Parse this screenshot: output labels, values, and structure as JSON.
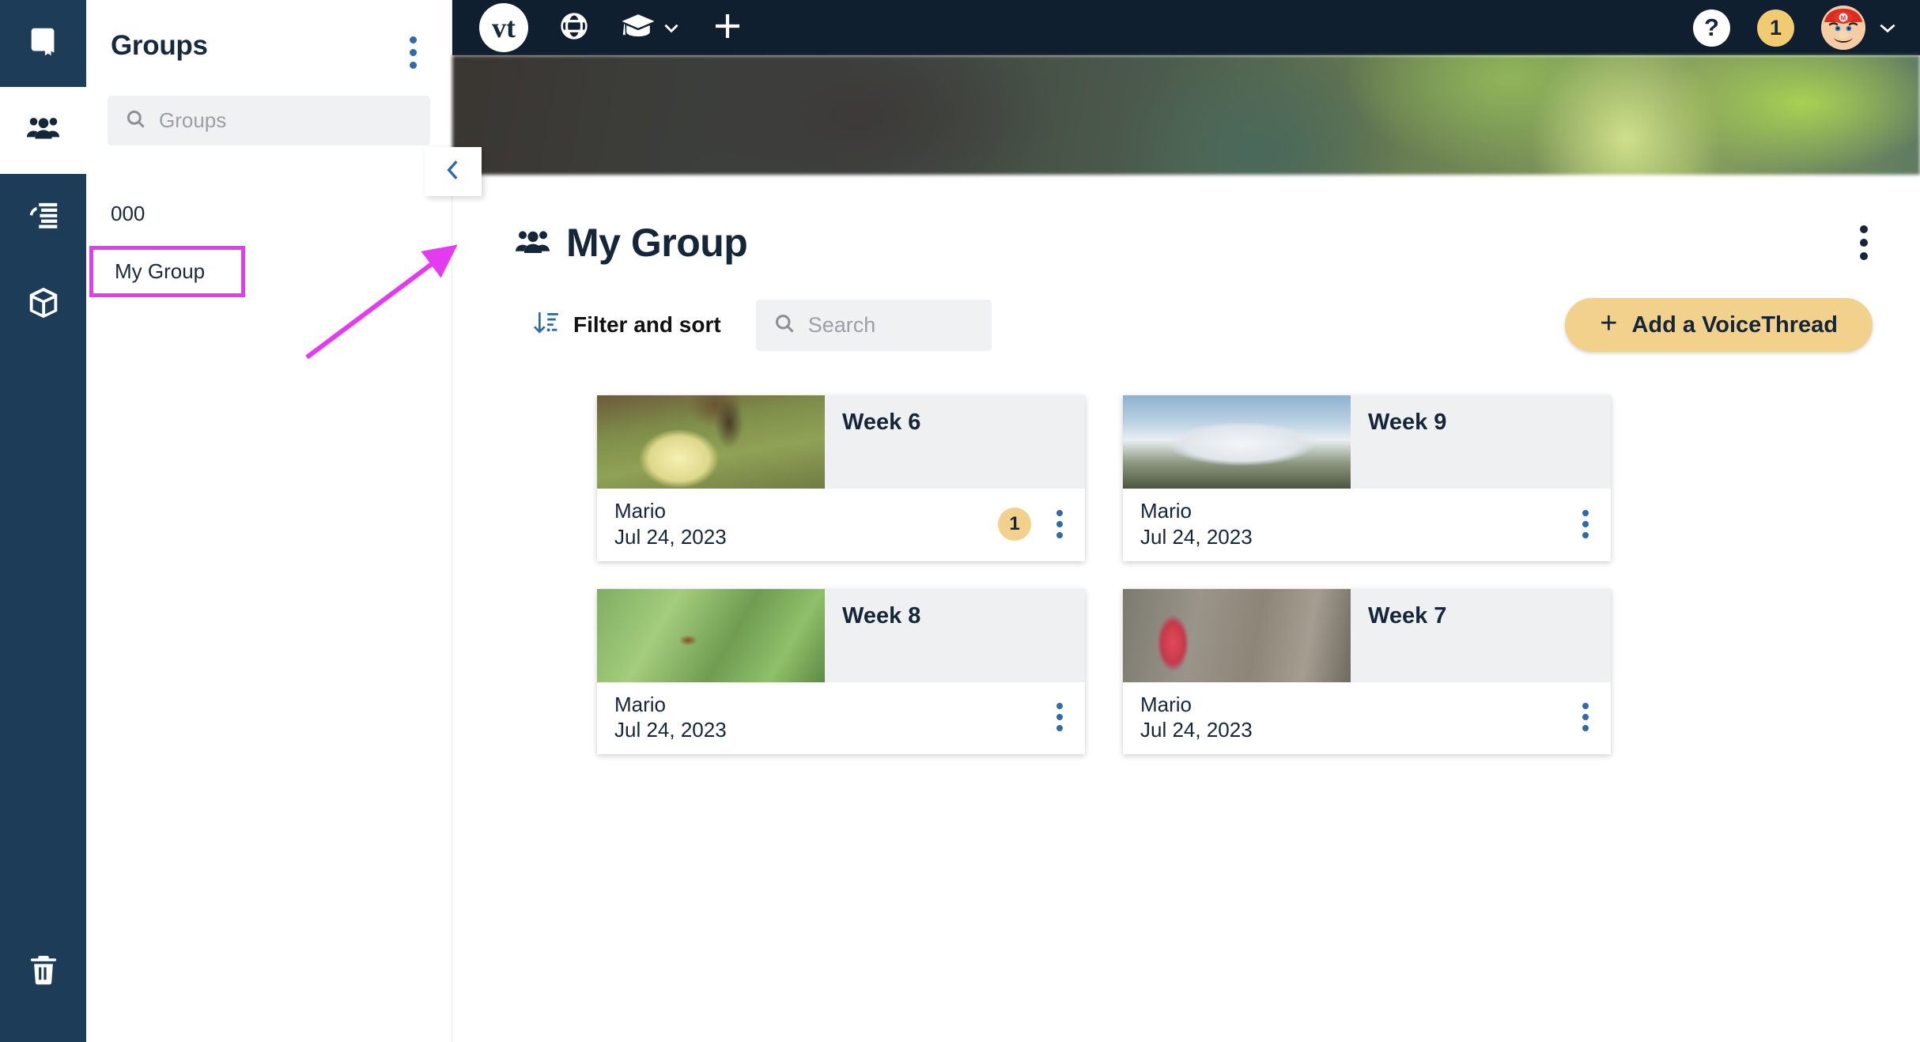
{
  "rail": {
    "items": [
      {
        "name": "courses",
        "icon": "book-icon",
        "active": false
      },
      {
        "name": "groups",
        "icon": "groups-icon",
        "active": true
      },
      {
        "name": "threads",
        "icon": "spool-icon",
        "active": false
      },
      {
        "name": "archive",
        "icon": "box-icon",
        "active": false
      }
    ],
    "trash": {
      "name": "trash",
      "icon": "trash-icon"
    }
  },
  "panel": {
    "title": "Groups",
    "menu_icon": "kebab-menu-icon",
    "search": {
      "placeholder": "Groups",
      "value": "",
      "icon": "search-icon"
    },
    "items": [
      {
        "label": "000",
        "highlighted": false
      },
      {
        "label": "My Group",
        "highlighted": true
      }
    ]
  },
  "collapse": {
    "icon": "chevron-left-icon",
    "label": ""
  },
  "annotation": {
    "highlight_color": "#e53bf0",
    "arrow_color": "#e53bf0",
    "target": "collapse-panel-tab"
  },
  "topnav": {
    "logo": "vt",
    "globe_icon": "globe-icon",
    "courses_icon": "graduation-cap-icon",
    "courses_chevron": "chevron-down-icon",
    "add_icon": "plus-icon",
    "help_label": "?",
    "notification_count": "1",
    "avatar": "mario-avatar",
    "account_chevron": "chevron-down-icon"
  },
  "page": {
    "icon": "groups-icon",
    "title": "My Group",
    "menu_icon": "kebab-menu-icon"
  },
  "toolbar": {
    "filter_sort_label": "Filter and sort",
    "filter_sort_icon": "sort-descending-icon",
    "search": {
      "placeholder": "Search",
      "value": "",
      "icon": "search-icon"
    },
    "add_button": {
      "label": "Add a VoiceThread",
      "plus": "+",
      "color": "#f2d18c"
    }
  },
  "cards": [
    {
      "title": "Week 6",
      "author": "Mario",
      "date": "Jul 24, 2023",
      "count": "1",
      "thumb_class": "thumb-gosling",
      "thumb_alt": "gosling-photo",
      "menu_icon": "kebab-menu-icon"
    },
    {
      "title": "Week 9",
      "author": "Mario",
      "date": "Jul 24, 2023",
      "count": "",
      "thumb_class": "thumb-clouds",
      "thumb_alt": "people-above-clouds-photo",
      "menu_icon": "kebab-menu-icon"
    },
    {
      "title": "Week 8",
      "author": "Mario",
      "date": "Jul 24, 2023",
      "count": "",
      "thumb_class": "thumb-bug",
      "thumb_alt": "insect-on-grass-photo",
      "menu_icon": "kebab-menu-icon"
    },
    {
      "title": "Week 7",
      "author": "Mario",
      "date": "Jul 24, 2023",
      "count": "",
      "thumb_class": "thumb-snowplant",
      "thumb_alt": "red-snow-plant-photo",
      "menu_icon": "kebab-menu-icon"
    }
  ],
  "colors": {
    "rail_bg": "#1d3c58",
    "topnav_bg": "#101f30",
    "accent_blue": "#2d6ca8",
    "accent_gold": "#f2d18c",
    "text_dark": "#16263a"
  }
}
